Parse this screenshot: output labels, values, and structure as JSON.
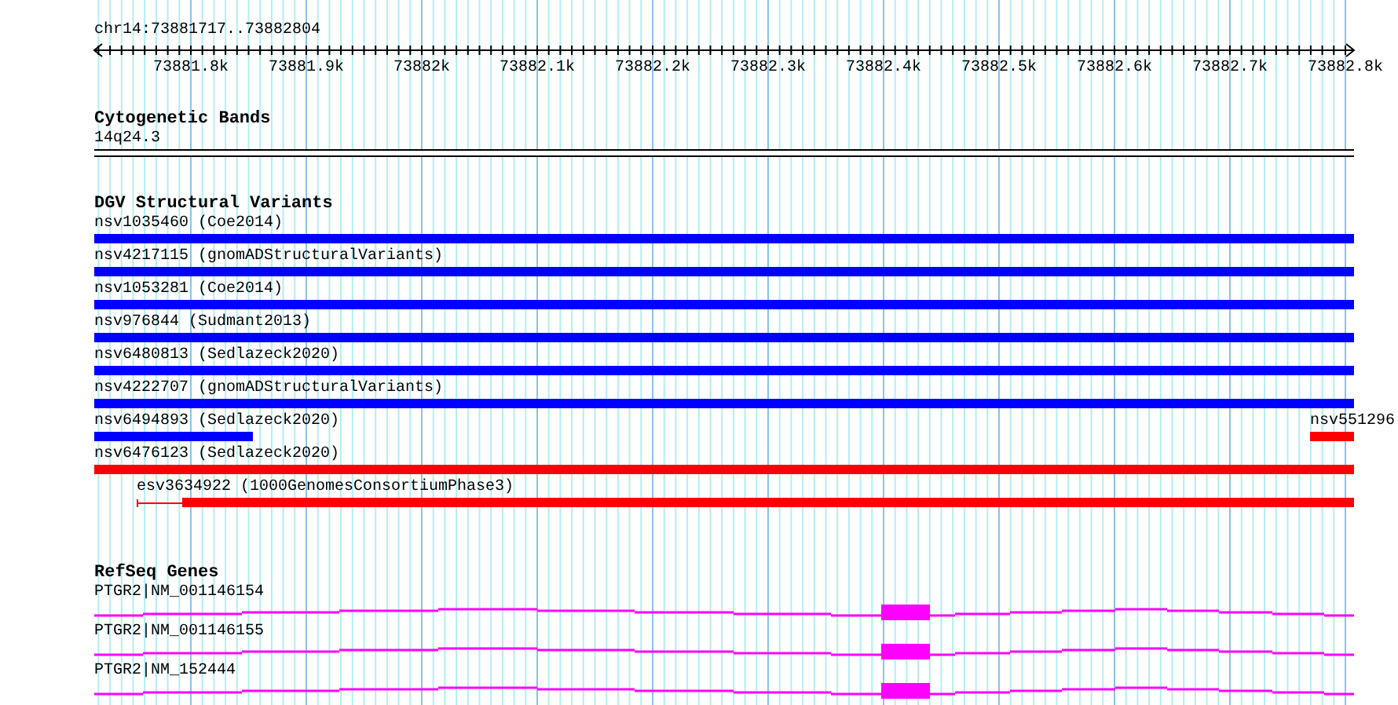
{
  "ruler": {
    "location": "chr14:73881717..73882804",
    "ticks": [
      "73881.8k",
      "73881.9k",
      "73882k",
      "73882.1k",
      "73882.2k",
      "73882.3k",
      "73882.4k",
      "73882.5k",
      "73882.6k",
      "73882.7k",
      "73882.8k"
    ]
  },
  "tracks": [
    {
      "kind": "cytoband",
      "title": "Cytogenetic Bands",
      "features": [
        {
          "label": "14q24.3"
        }
      ]
    },
    {
      "kind": "variants",
      "title": "DGV Structural Variants",
      "rows": [
        {
          "features": [
            {
              "label": "nsv1035460 (Coe2014)",
              "color": "#0000ff"
            }
          ]
        },
        {
          "features": [
            {
              "label": "nsv4217115 (gnomADStructuralVariants)",
              "color": "#0000ff"
            }
          ]
        },
        {
          "features": [
            {
              "label": "nsv1053281 (Coe2014)",
              "color": "#0000ff"
            }
          ]
        },
        {
          "features": [
            {
              "label": "nsv976844 (Sudmant2013)",
              "color": "#0000ff"
            }
          ]
        },
        {
          "features": [
            {
              "label": "nsv6480813 (Sedlazeck2020)",
              "color": "#0000ff"
            }
          ]
        },
        {
          "features": [
            {
              "label": "nsv4222707 (gnomADStructuralVariants)",
              "color": "#0000ff"
            }
          ]
        },
        {
          "features": [
            {
              "label": "nsv6494893 (Sedlazeck2020)",
              "color": "#0000ff"
            },
            {
              "label": "nsv551296",
              "color": "#ff0000"
            }
          ]
        },
        {
          "features": [
            {
              "label": "nsv6476123 (Sedlazeck2020)",
              "color": "#ff0000"
            }
          ]
        },
        {
          "features": [
            {
              "label": "esv3634922 (1000GenomesConsortiumPhase3)",
              "color": "#ff0000"
            }
          ]
        }
      ]
    },
    {
      "kind": "genes",
      "title": "RefSeq Genes",
      "features": [
        {
          "label": "PTGR2|NM_001146154"
        },
        {
          "label": "PTGR2|NM_001146155"
        },
        {
          "label": "PTGR2|NM_152444"
        }
      ]
    }
  ]
}
